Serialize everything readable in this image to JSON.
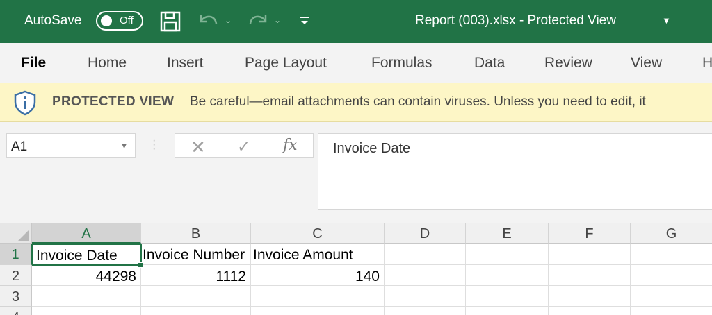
{
  "titlebar": {
    "autosave_label": "AutoSave",
    "autosave_state": "Off",
    "title": "Report (003).xlsx  -  Protected View"
  },
  "ribbon": {
    "tabs": [
      "File",
      "Home",
      "Insert",
      "Page Layout",
      "Formulas",
      "Data",
      "Review",
      "View",
      "H"
    ]
  },
  "protected_view": {
    "title": "PROTECTED VIEW",
    "message": "Be careful—email attachments can contain viruses. Unless you need to edit, it"
  },
  "formula_bar": {
    "name_box": "A1",
    "fx_label": "fx",
    "content": "Invoice Date"
  },
  "sheet": {
    "columns": [
      "A",
      "B",
      "C",
      "D",
      "E",
      "F",
      "G"
    ],
    "rows": [
      "1",
      "2",
      "3",
      "4"
    ],
    "cells": {
      "A1": "Invoice Date",
      "B1": "Invoice Number",
      "C1": "Invoice Amount",
      "A2": "44298",
      "B2": "1112",
      "C2": "140"
    }
  },
  "colors": {
    "excel_green": "#217346",
    "protected_bar": "#fdf6c6"
  },
  "icons": [
    "save-icon",
    "undo-icon",
    "redo-icon",
    "customize-qat-icon",
    "shield-info-icon",
    "cancel-icon",
    "enter-icon"
  ]
}
